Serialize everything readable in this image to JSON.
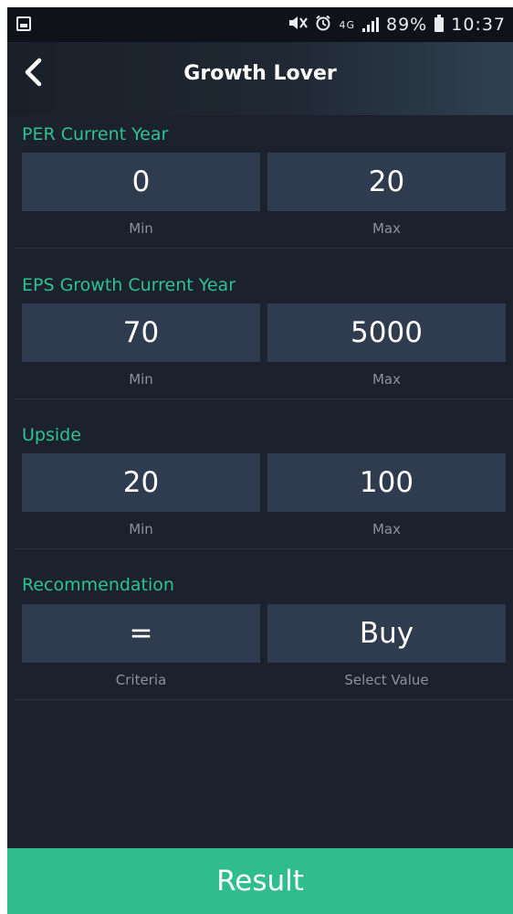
{
  "status_bar": {
    "network": "4G",
    "battery_percent": "89%",
    "time": "10:37",
    "icons": [
      "gallery-icon",
      "mute-icon",
      "alarm-icon",
      "signal-icon",
      "battery-icon"
    ]
  },
  "header": {
    "title": "Growth Lover",
    "back_icon": "chevron-left-icon"
  },
  "sections": [
    {
      "label": "PER Current Year",
      "left_value": "0",
      "right_value": "20",
      "left_caption": "Min",
      "right_caption": "Max"
    },
    {
      "label": "EPS Growth Current Year",
      "left_value": "70",
      "right_value": "5000",
      "left_caption": "Min",
      "right_caption": "Max"
    },
    {
      "label": "Upside",
      "left_value": "20",
      "right_value": "100",
      "left_caption": "Min",
      "right_caption": "Max"
    },
    {
      "label": "Recommendation",
      "left_value": "=",
      "right_value": "Buy",
      "left_caption": "Criteria",
      "right_caption": "Select Value"
    }
  ],
  "result_button": {
    "label": "Result"
  },
  "colors": {
    "background": "#1b222d",
    "field": "#2f3b4e",
    "accent": "#2fbd8e",
    "label": "#2fc192",
    "caption": "#8a929c"
  }
}
